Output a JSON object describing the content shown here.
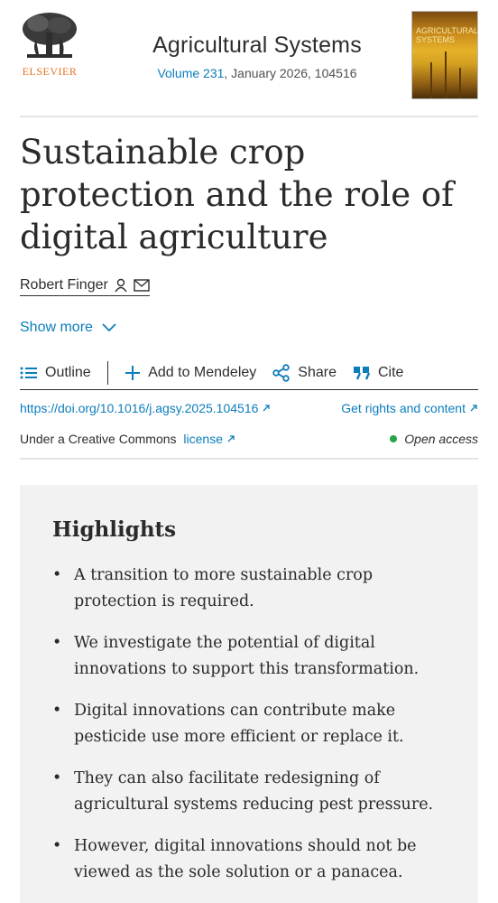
{
  "publisher": {
    "name": "ELSEVIER"
  },
  "journal": {
    "title": "Agricultural Systems",
    "volume_link": "Volume 231",
    "issue_info": ", January 2026, 104516",
    "cover_text": "AGRICULTURAL SYSTEMS"
  },
  "article": {
    "title": "Sustainable crop protection and the role of digital agriculture",
    "author": "Robert Finger",
    "show_more": "Show more"
  },
  "toolbar": {
    "outline": "Outline",
    "mendeley": "Add to Mendeley",
    "share": "Share",
    "cite": "Cite"
  },
  "links": {
    "doi": "https://doi.org/10.1016/j.agsy.2025.104516",
    "rights": "Get rights and content",
    "license_prefix": "Under a Creative Commons ",
    "license_link": "license",
    "open_access": "Open access"
  },
  "highlights": {
    "title": "Highlights",
    "items": [
      "A transition to more sustainable crop protection is required.",
      "We investigate the potential of digital innovations to support this transformation.",
      "Digital innovations can contribute make pesticide use more efficient or replace it.",
      "They can also facilitate redesigning of agricultural systems reducing pest pressure.",
      "However, digital innovations should not be viewed as the sole solution or a panacea."
    ]
  },
  "colors": {
    "link": "#0c7dbb",
    "brand_orange": "#e9711c",
    "open_access_dot": "#2aa24a",
    "highlights_bg": "#f2f2f2"
  },
  "icons": [
    "tree-logo-icon",
    "person-icon",
    "envelope-icon",
    "chevron-down-icon",
    "list-icon",
    "plus-icon",
    "share-icon",
    "quote-icon",
    "external-link-icon"
  ]
}
